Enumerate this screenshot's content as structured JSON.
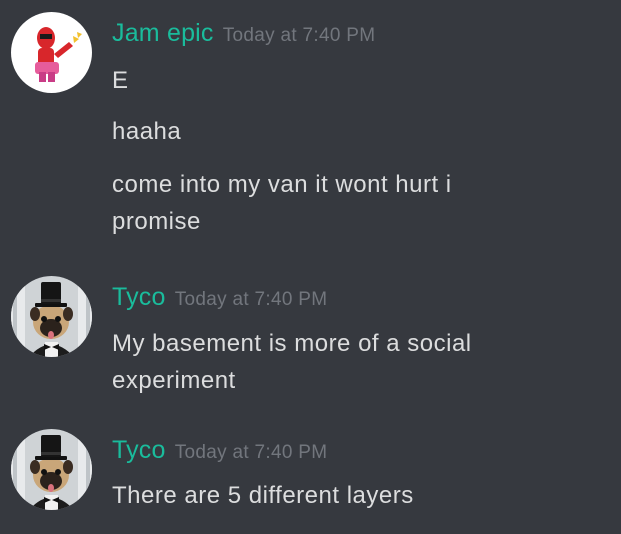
{
  "colors": {
    "background": "#36393f",
    "username": "#1abc9c",
    "timestamp": "#72767d",
    "message_text": "#dcddde"
  },
  "groups": [
    {
      "author": "Jam epic",
      "timestamp": "Today at 7:40 PM",
      "avatar_icon": "red-figure-avatar",
      "messages": [
        "E",
        "haaha",
        "come into my van it wont hurt i",
        "promise"
      ]
    },
    {
      "author": "Tyco",
      "timestamp": "Today at 7:40 PM",
      "avatar_icon": "pug-top-hat-avatar",
      "messages": [
        "My basement is more of a social",
        "experiment"
      ]
    },
    {
      "author": "Tyco",
      "timestamp": "Today at 7:40 PM",
      "avatar_icon": "pug-top-hat-avatar",
      "messages": [
        "There are 5 different layers"
      ]
    }
  ]
}
